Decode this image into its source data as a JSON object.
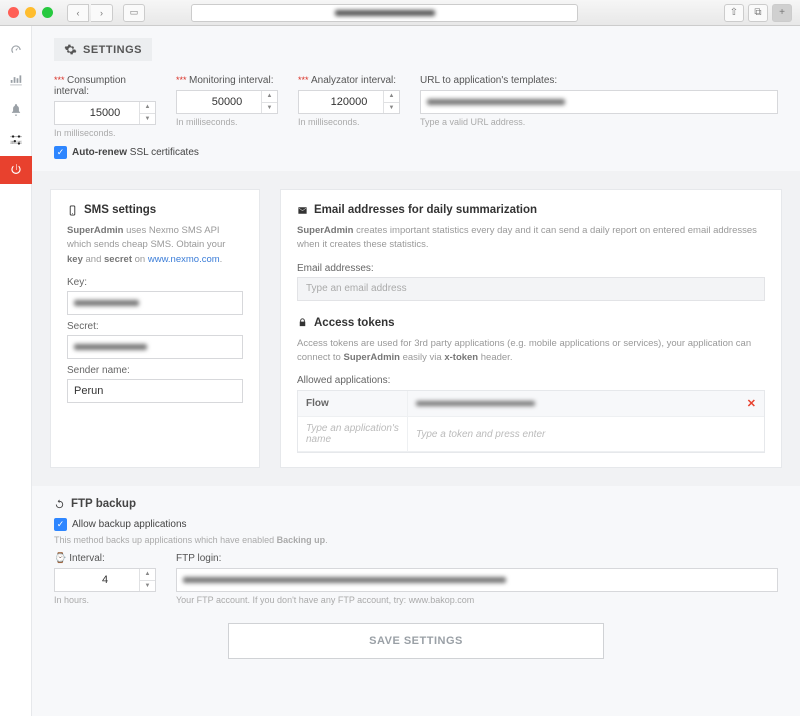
{
  "header": {
    "title": "SETTINGS"
  },
  "intervals": {
    "consumption": {
      "label": "Consumption interval:",
      "value": "15000",
      "help": "In milliseconds."
    },
    "monitoring": {
      "label": "Monitoring interval:",
      "value": "50000",
      "help": "In milliseconds."
    },
    "analyzator": {
      "label": "Analyzator interval:",
      "value": "120000",
      "help": "In milliseconds."
    },
    "url": {
      "label": "URL to application's templates:",
      "help": "Type a valid URL address."
    }
  },
  "ssl": {
    "label_strong": "Auto-renew",
    "label_rest": " SSL certificates"
  },
  "sms": {
    "title": "SMS settings",
    "desc_prefix": " uses Nexmo SMS API which sends cheap SMS. Obtain your ",
    "desc_key": "key",
    "desc_and": " and ",
    "desc_secret": "secret",
    "desc_on": " on ",
    "link_text": "www.nexmo.com",
    "key_label": "Key:",
    "secret_label": "Secret:",
    "sender_label": "Sender name:",
    "sender_value": "Perun"
  },
  "email": {
    "title": "Email addresses for daily summarization",
    "desc_prefix": " creates important statistics every day and it can send a daily report on entered email addresses when it creates these statistics.",
    "addresses_label": "Email addresses:",
    "addresses_placeholder": "Type an email address"
  },
  "tokens": {
    "title": "Access tokens",
    "desc_prefix": "Access tokens are used for 3rd party applications (e.g. mobile applications or services), your application can connect to ",
    "desc_via": " easily via ",
    "desc_header": "x-token",
    "desc_tail": " header.",
    "allowed_label": "Allowed applications:",
    "row_name": "Flow",
    "name_placeholder": "Type an application's name",
    "token_placeholder": "Type a token and press enter"
  },
  "brand": "SuperAdmin",
  "ftp": {
    "title": "FTP backup",
    "allow_label": "Allow backup applications",
    "help_prefix": "This method backs up applications which have enabled ",
    "help_bold": "Backing up",
    "interval_label": "Interval:",
    "interval_value": "4",
    "interval_help": "In hours.",
    "login_label": "FTP login:",
    "login_help_prefix": "Your FTP account. If you don't have any FTP account, try: ",
    "login_link": "www.bakop.com"
  },
  "save": "SAVE SETTINGS"
}
